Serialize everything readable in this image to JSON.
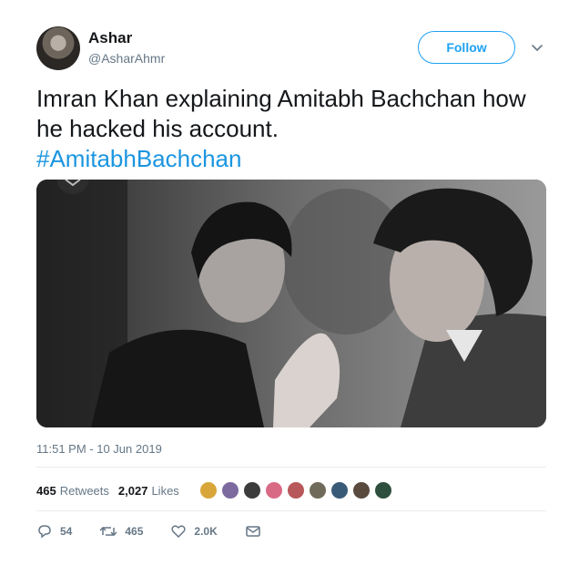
{
  "header": {
    "display_name": "Ashar",
    "handle": "@AsharAhmr",
    "follow_label": "Follow"
  },
  "tweet": {
    "text_line": "Imran Khan explaining Amitabh Bachchan how he hacked his account.",
    "hashtag": "#AmitabhBachchan",
    "timestamp": "11:51 PM - 10 Jun 2019"
  },
  "stats": {
    "retweets_count": "465",
    "retweets_label": "Retweets",
    "likes_count": "2,027",
    "likes_label": "Likes"
  },
  "actions": {
    "reply_count": "54",
    "retweet_count": "465",
    "like_count": "2.0K"
  },
  "colors": {
    "accent": "#1da1f2",
    "hashtag": "#1b95e0",
    "muted": "#657786"
  },
  "icons": {
    "caret": "chevron-down-icon",
    "reply": "reply-icon",
    "retweet": "retweet-icon",
    "like": "heart-icon",
    "dm": "envelope-icon"
  }
}
